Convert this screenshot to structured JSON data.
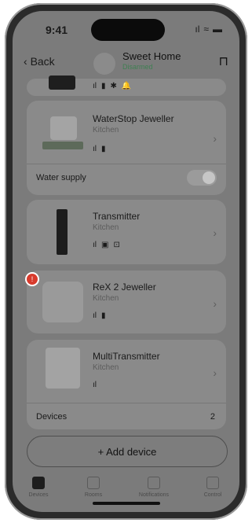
{
  "status_bar": {
    "time": "9:41",
    "signal": "ıl",
    "wifi": "≈",
    "battery": "▬"
  },
  "nav": {
    "back_label": "Back",
    "title": "Sweet Home",
    "subtitle": "Disarmed"
  },
  "top_partial_card": {
    "icons": [
      "ıl",
      "▮",
      "✱",
      "🔔"
    ]
  },
  "devices": [
    {
      "name": "WaterStop Jeweller",
      "room": "Kitchen",
      "icons": [
        "ıl",
        "▮"
      ],
      "extra_label": "Water supply"
    },
    {
      "name": "Transmitter",
      "room": "Kitchen",
      "icons": [
        "ıl",
        "▣",
        "⊡"
      ]
    },
    {
      "name": "ReX 2 Jeweller",
      "room": "Kitchen",
      "icons": [
        "ıl",
        "▮"
      ],
      "badge": "!"
    },
    {
      "name": "MultiTransmitter",
      "room": "Kitchen",
      "icons": [
        "ıl"
      ],
      "extra_label": "Devices",
      "extra_value": "2"
    }
  ],
  "add_button": {
    "label": "+ Add device"
  },
  "tabs": [
    {
      "label": "Devices",
      "active": true
    },
    {
      "label": "Rooms",
      "active": false
    },
    {
      "label": "Notifications",
      "active": false
    },
    {
      "label": "Control",
      "active": false
    }
  ]
}
